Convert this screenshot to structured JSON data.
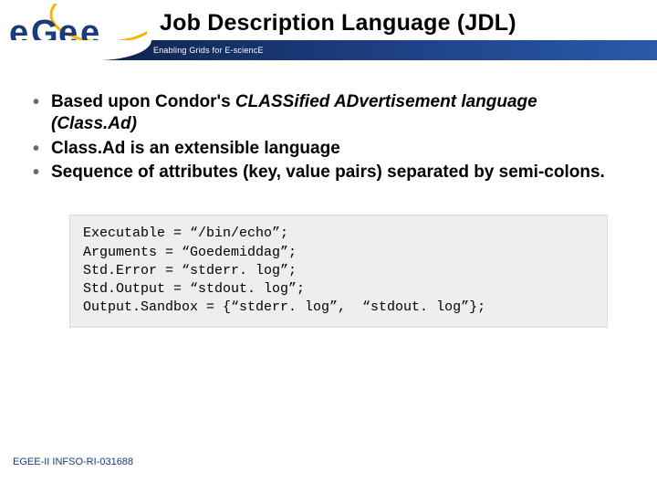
{
  "header": {
    "title": "Job Description Language (JDL)",
    "tagline": "Enabling Grids for E-sciencE",
    "logo": {
      "text_top": "e",
      "text_rest": "Gee"
    }
  },
  "bullets": [
    {
      "prefix": "Based upon Condor's ",
      "em": "CLASSified ADvertisement language (Class.Ad)",
      "suffix": ""
    },
    {
      "prefix": "Class.Ad is an extensible language",
      "em": "",
      "suffix": ""
    },
    {
      "prefix": "Sequence of attributes (key, value pairs) separated by semi-colons.",
      "em": "",
      "suffix": ""
    }
  ],
  "code": "Executable = “/bin/echo”;\nArguments = “Goedemiddag”;\nStd.Error = “stderr. log”;\nStd.Output = “stdout. log”;\nOutput.Sandbox = {“stderr. log”,  “stdout. log”};",
  "footer": "EGEE-II INFSO-RI-031688"
}
